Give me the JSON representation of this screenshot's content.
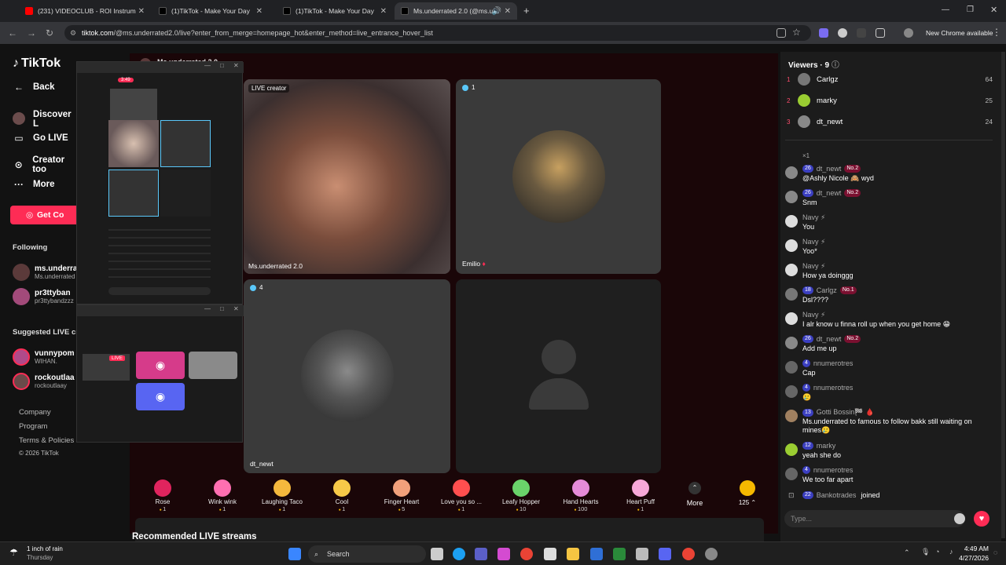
{
  "browser": {
    "tabs": [
      {
        "label": "(231) VIDEOCLUB - ROI Instrum",
        "color": "#ff0000"
      },
      {
        "label": "(1)TikTok - Make Your Day",
        "color": "#111111"
      },
      {
        "label": "(1)TikTok - Make Your Day",
        "color": "#111111"
      },
      {
        "label": "Ms.underrated 2.0 (@ms.u",
        "color": "#111111"
      }
    ],
    "url_host": "tiktok.com",
    "url_path": "/@ms.underrated2.0/live?enter_from_merge=homepage_hot&enter_method=live_entrance_hover_list",
    "new_chrome": "New Chrome available"
  },
  "nav": {
    "logo": "TikTok",
    "back": "Back",
    "discover": "Discover L",
    "go_live": "Go LIVE",
    "creator": "Creator too",
    "more": "More",
    "get_coins": "Get Co",
    "following": "Following",
    "suggested": "Suggested LIVE cr",
    "following_users": [
      {
        "name": "ms.underrat",
        "sub": "Ms.underrated"
      },
      {
        "name": "pr3ttyban",
        "sub": "pr3ttybandzzz"
      }
    ],
    "suggested_users": [
      {
        "name": "vunnypom",
        "sub": "WIHAN."
      },
      {
        "name": "rockoutlaa",
        "sub": "rockoutlaay"
      }
    ],
    "footer": [
      "Company",
      "Program",
      "Terms & Policies",
      "© 2026 TikTok"
    ]
  },
  "stage": {
    "header_name": "Ms.underrated 2.0",
    "tile1_badge": "LIVE creator",
    "tile1_name": "Ms.underrated 2.0",
    "tile2_count": "1",
    "tile2_name": "Emilio",
    "tile3_count": "4",
    "tile3_name": "dt_newt",
    "recommended": "Recommended LIVE streams"
  },
  "gifts": [
    {
      "name": "Rose",
      "cost": "1",
      "color": "#e0245e"
    },
    {
      "name": "Wink wink",
      "cost": "1",
      "color": "#ff6fb1"
    },
    {
      "name": "Laughing Taco",
      "cost": "1",
      "color": "#f5b83d"
    },
    {
      "name": "Cool",
      "cost": "1",
      "color": "#f7c948"
    },
    {
      "name": "Finger Heart",
      "cost": "5",
      "color": "#f2a07b"
    },
    {
      "name": "Love you so ...",
      "cost": "1",
      "color": "#ff4f4f"
    },
    {
      "name": "Leafy Hopper",
      "cost": "10",
      "color": "#6ad36a"
    },
    {
      "name": "Hand Hearts",
      "cost": "100",
      "color": "#e58bd8"
    },
    {
      "name": "Heart Puff",
      "cost": "1",
      "color": "#f7a8d8"
    }
  ],
  "gift_more": "More",
  "coin_balance": "125",
  "viewers": {
    "title": "Viewers · 9",
    "list": [
      {
        "rank": "1",
        "name": "Carlgz",
        "score": "64",
        "color": "#777"
      },
      {
        "rank": "2",
        "name": "marky",
        "score": "25",
        "color": "#9acd32"
      },
      {
        "rank": "3",
        "name": "dt_newt",
        "score": "24",
        "color": "#888"
      }
    ]
  },
  "chat": {
    "multiplier": "×1",
    "messages": [
      {
        "lvl": "26",
        "user": "dt_newt",
        "rank": "No.2",
        "text": "@Ashly Nicole 🙈 wyd",
        "color": "#888"
      },
      {
        "lvl": "26",
        "user": "dt_newt",
        "rank": "No.2",
        "text": "Snm",
        "color": "#888"
      },
      {
        "lvl": "",
        "user": "Navy ⚡",
        "rank": "",
        "text": "You",
        "color": "#ddd"
      },
      {
        "lvl": "",
        "user": "Navy ⚡",
        "rank": "",
        "text": "Yoo*",
        "color": "#ddd"
      },
      {
        "lvl": "",
        "user": "Navy ⚡",
        "rank": "",
        "text": "How ya doinggg",
        "color": "#ddd"
      },
      {
        "lvl": "18",
        "user": "Carlgz",
        "rank": "No.1",
        "text": "Dsl????",
        "color": "#777"
      },
      {
        "lvl": "",
        "user": "Navy ⚡",
        "rank": "",
        "text": "I alr know u finna roll up when you get home 😁",
        "color": "#ddd"
      },
      {
        "lvl": "26",
        "user": "dt_newt",
        "rank": "No.2",
        "text": "Add me up",
        "color": "#888"
      },
      {
        "lvl": "4",
        "user": "nnumerotres",
        "rank": "",
        "text": "Cap",
        "color": "#666"
      },
      {
        "lvl": "4",
        "user": "nnumerotres",
        "rank": "",
        "text": "🥲",
        "color": "#666"
      },
      {
        "lvl": "13",
        "user": "Gotti Bossin🏁 🩸",
        "rank": "",
        "text": "Ms.underrated to famous to follow bakk still waiting on mines🥲",
        "color": "#a08060"
      },
      {
        "lvl": "12",
        "user": "marky",
        "rank": "",
        "text": "yeah she do",
        "color": "#9acd32"
      },
      {
        "lvl": "4",
        "user": "nnumerotres",
        "rank": "",
        "text": "We too far apart",
        "color": "#666"
      }
    ],
    "joined_lvl": "22",
    "joined_user": "Bankotrades",
    "joined_text": "joined",
    "input_placeholder": "Type..."
  },
  "overlay": {
    "time": "3:49",
    "live_badge": "LIVE"
  },
  "taskbar": {
    "weather": "1 inch of rain",
    "day": "Thursday",
    "search": "Search",
    "time": "4:49 AM",
    "date": "4/27/2026"
  }
}
